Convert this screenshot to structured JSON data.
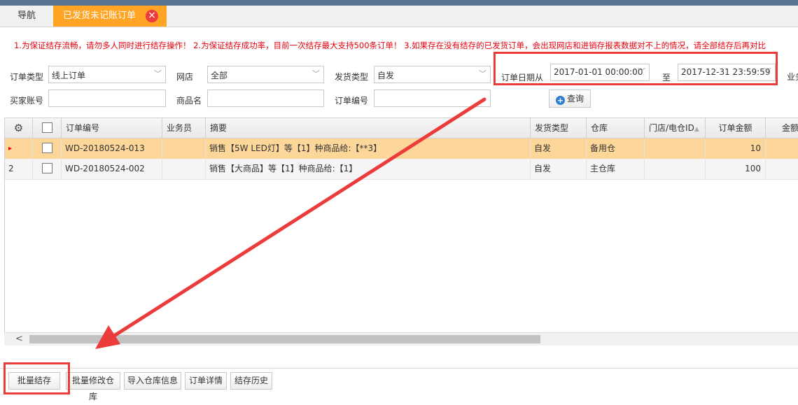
{
  "tabs": {
    "nav_label": "导航",
    "active_label": "已发货未记账订单",
    "close_glyph": "×"
  },
  "notice": "1.为保证结存流畅，请勿多人同时进行结存操作！ 2.为保证结存成功率，目前一次结存最大支持500条订单！ 3.如果存在没有结存的已发货订单，会出现网店和进销存报表数据对不上的情况，请全部结存后再对比",
  "filters": {
    "order_type_label": "订单类型",
    "order_type_value": "线上订单",
    "shop_label": "网店",
    "shop_value": "全部",
    "ship_type_label": "发货类型",
    "ship_type_value": "自发",
    "date_from_label": "订单日期从",
    "date_from_value": "2017-01-01 00:00:00",
    "date_to_label": "至",
    "date_to_value": "2017-12-31 23:59:59",
    "truncated_label": "业务",
    "buyer_label": "买家账号",
    "buyer_value": "",
    "product_label": "商品名",
    "product_value": "",
    "order_no_label": "订单编号",
    "order_no_value": "",
    "query_label": "查询"
  },
  "table": {
    "headers": {
      "order_no": "订单编号",
      "salesman": "业务员",
      "summary": "摘要",
      "ship_type": "发货类型",
      "warehouse": "仓库",
      "store": "门店/电仓ID",
      "amount": "订单金额",
      "truncated": "金额"
    },
    "rows": [
      {
        "index": "▸",
        "order_no": "WD-20180524-013",
        "salesman": "",
        "summary": "销售【5W LED灯】等【1】种商品给:【**3】",
        "ship_type": "自发",
        "warehouse": "备用仓",
        "store": "",
        "amount": "10"
      },
      {
        "index": "2",
        "order_no": "WD-20180524-002",
        "salesman": "",
        "summary": "销售【大商品】等【1】种商品给:【1】",
        "ship_type": "自发",
        "warehouse": "主仓库",
        "store": "",
        "amount": "100"
      }
    ]
  },
  "actions": {
    "batch_settle": "批量结存",
    "batch_edit_warehouse": "批量修改仓库",
    "import_warehouse": "导入仓库信息",
    "order_detail": "订单详情",
    "settle_history": "结存历史"
  },
  "colors": {
    "accent_tab": "#ffa424",
    "selected_row": "#fdd79a",
    "annotation_red": "#ec3b3b",
    "notice_red": "#e8000c"
  }
}
